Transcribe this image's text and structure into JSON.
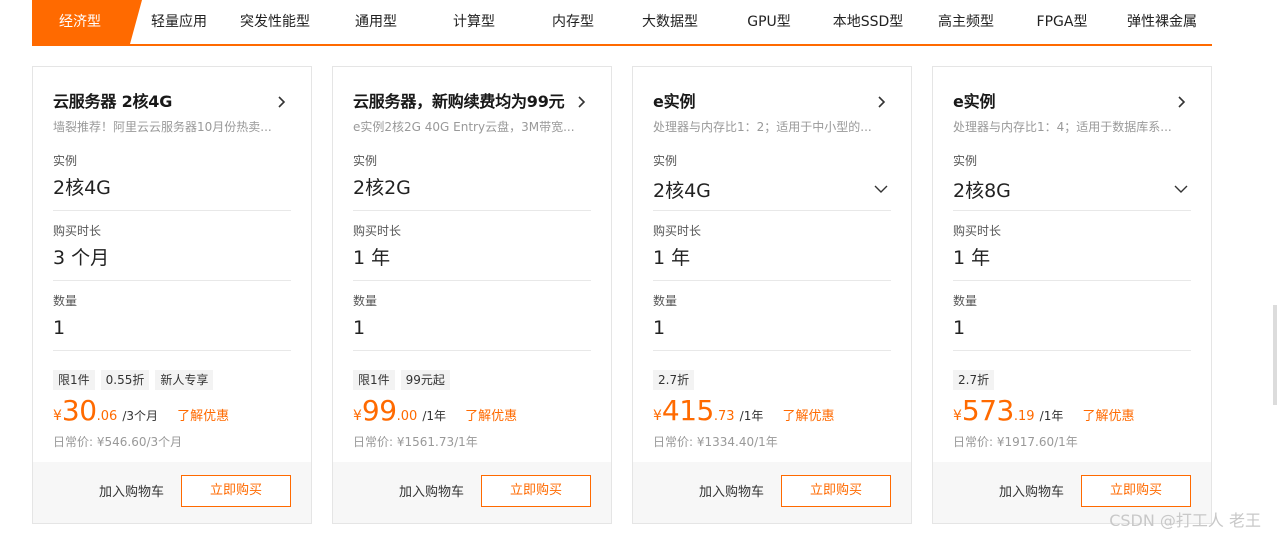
{
  "tabs": [
    "经济型",
    "轻量应用",
    "突发性能型",
    "通用型",
    "计算型",
    "内存型",
    "大数据型",
    "GPU型",
    "本地SSD型",
    "高主频型",
    "FPGA型",
    "弹性裸金属"
  ],
  "colors": {
    "accent": "#ff6a00"
  },
  "cards": [
    {
      "title": "云服务器 2核4G",
      "subtitle": "墙裂推荐！阿里云云服务器10月份热卖...",
      "fields": [
        {
          "label": "实例",
          "value": "2核4G"
        },
        {
          "label": "购买时长",
          "value": "3 个月"
        },
        {
          "label": "数量",
          "value": "1"
        }
      ],
      "tags": [
        "限1件",
        "0.55折",
        "新人专享"
      ],
      "price": {
        "symbol": "¥",
        "integer": "30",
        "decimal": ".06",
        "unit": "/3个月"
      },
      "learn_more": "了解优惠",
      "regular_price": "日常价: ¥546.60/3个月",
      "add_to_cart": "加入购物车",
      "buy_now": "立即购买"
    },
    {
      "title": "云服务器，新购续费均为99元",
      "subtitle": "e实例2核2G 40G Entry云盘，3M带宽...",
      "fields": [
        {
          "label": "实例",
          "value": "2核2G"
        },
        {
          "label": "购买时长",
          "value": "1 年"
        },
        {
          "label": "数量",
          "value": "1"
        }
      ],
      "tags": [
        "限1件",
        "99元起"
      ],
      "price": {
        "symbol": "¥",
        "integer": "99",
        "decimal": ".00",
        "unit": "/1年"
      },
      "learn_more": "了解优惠",
      "regular_price": "日常价: ¥1561.73/1年",
      "add_to_cart": "加入购物车",
      "buy_now": "立即购买"
    },
    {
      "title": "e实例",
      "subtitle": "处理器与内存比1：2；适用于中小型的...",
      "fields": [
        {
          "label": "实例",
          "value": "2核4G"
        },
        {
          "label": "购买时长",
          "value": "1 年"
        },
        {
          "label": "数量",
          "value": "1"
        }
      ],
      "tags": [
        "2.7折"
      ],
      "price": {
        "symbol": "¥",
        "integer": "415",
        "decimal": ".73",
        "unit": "/1年"
      },
      "learn_more": "了解优惠",
      "regular_price": "日常价: ¥1334.40/1年",
      "add_to_cart": "加入购物车",
      "buy_now": "立即购买"
    },
    {
      "title": "e实例",
      "subtitle": "处理器与内存比1：4；适用于数据库系...",
      "fields": [
        {
          "label": "实例",
          "value": "2核8G"
        },
        {
          "label": "购买时长",
          "value": "1 年"
        },
        {
          "label": "数量",
          "value": "1"
        }
      ],
      "tags": [
        "2.7折"
      ],
      "price": {
        "symbol": "¥",
        "integer": "573",
        "decimal": ".19",
        "unit": "/1年"
      },
      "learn_more": "了解优惠",
      "regular_price": "日常价: ¥1917.60/1年",
      "add_to_cart": "加入购物车",
      "buy_now": "立即购买"
    }
  ],
  "watermark": "CSDN @打工人 老王"
}
